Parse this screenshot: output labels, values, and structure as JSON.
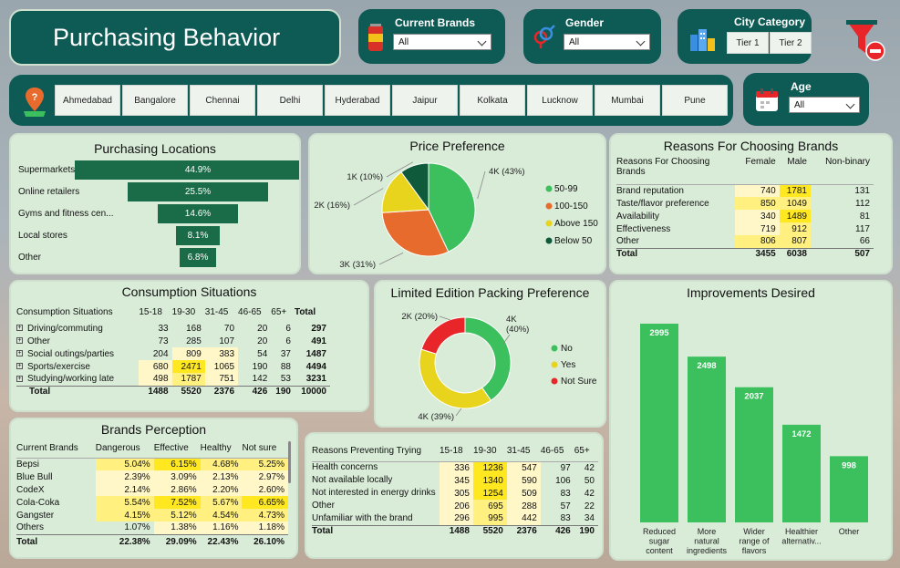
{
  "header": {
    "title": "Purchasing Behavior"
  },
  "filters": {
    "current_brands": {
      "label": "Current Brands",
      "value": "All",
      "icon": "energy-can-icon"
    },
    "gender": {
      "label": "Gender",
      "value": "All",
      "icon": "gender-icon"
    },
    "city_category": {
      "label": "City Category",
      "tiers": [
        "Tier 1",
        "Tier 2"
      ],
      "icon": "city-buildings-icon"
    },
    "clear_filters_icon": "filter-clear-icon",
    "cities": [
      "Ahmedabad",
      "Bangalore",
      "Chennai",
      "Delhi",
      "Hyderabad",
      "Jaipur",
      "Kolkata",
      "Lucknow",
      "Mumbai",
      "Pune"
    ],
    "city_icon": "map-pin-icon",
    "age": {
      "label": "Age",
      "value": "All",
      "icon": "calendar-icon"
    }
  },
  "purchasing_locations": {
    "title": "Purchasing Locations",
    "items": [
      {
        "label": "Supermarkets",
        "value": "44.9%",
        "pct": 44.9
      },
      {
        "label": "Online retailers",
        "value": "25.5%",
        "pct": 25.5
      },
      {
        "label": "Gyms and fitness cen...",
        "value": "14.6%",
        "pct": 14.6
      },
      {
        "label": "Local stores",
        "value": "8.1%",
        "pct": 8.1
      },
      {
        "label": "Other",
        "value": "6.8%",
        "pct": 6.8
      }
    ]
  },
  "price_preference": {
    "title": "Price Preference",
    "chart_data": {
      "type": "pie",
      "slices": [
        {
          "label": "50-99",
          "value": 43,
          "text": "4K (43%)",
          "color": "#3cbf5d"
        },
        {
          "label": "100-150",
          "value": 31,
          "text": "3K (31%)",
          "color": "#e86b2e"
        },
        {
          "label": "Above 150",
          "value": 16,
          "text": "2K (16%)",
          "color": "#e8d41c"
        },
        {
          "label": "Below 50",
          "value": 10,
          "text": "1K (10%)",
          "color": "#0e5a3a"
        }
      ]
    }
  },
  "reasons_choosing": {
    "title": "Reasons For Choosing Brands",
    "headers": [
      "Reasons For Choosing Brands",
      "Female",
      "Male",
      "Non-binary"
    ],
    "rows": [
      [
        "Brand reputation",
        "740",
        "1781",
        "131"
      ],
      [
        "Taste/flavor preference",
        "850",
        "1049",
        "112"
      ],
      [
        "Availability",
        "340",
        "1489",
        "81"
      ],
      [
        "Effectiveness",
        "719",
        "912",
        "117"
      ],
      [
        "Other",
        "806",
        "807",
        "66"
      ]
    ],
    "total": [
      "Total",
      "3455",
      "6038",
      "507"
    ]
  },
  "consumption": {
    "title": "Consumption Situations",
    "headers": [
      "Consumption Situations",
      "15-18",
      "19-30",
      "31-45",
      "46-65",
      "65+",
      "Total"
    ],
    "rows": [
      [
        "Driving/commuting",
        "33",
        "168",
        "70",
        "20",
        "6",
        "297"
      ],
      [
        "Other",
        "73",
        "285",
        "107",
        "20",
        "6",
        "491"
      ],
      [
        "Social outings/parties",
        "204",
        "809",
        "383",
        "54",
        "37",
        "1487"
      ],
      [
        "Sports/exercise",
        "680",
        "2471",
        "1065",
        "190",
        "88",
        "4494"
      ],
      [
        "Studying/working late",
        "498",
        "1787",
        "751",
        "142",
        "53",
        "3231"
      ]
    ],
    "total": [
      "Total",
      "1488",
      "5520",
      "2376",
      "426",
      "190",
      "10000"
    ]
  },
  "limited_edition": {
    "title": "Limited Edition Packing Preference",
    "chart_data": {
      "type": "pie",
      "slices": [
        {
          "label": "No",
          "value": 40,
          "text_a": "4K",
          "text_b": "(40%)",
          "color": "#3cbf5d"
        },
        {
          "label": "Yes",
          "value": 39,
          "text_a": "4K (39%)",
          "color": "#e8d41c"
        },
        {
          "label": "Not Sure",
          "value": 20,
          "text_a": "2K (20%)",
          "color": "#e8262a"
        }
      ]
    }
  },
  "improvements": {
    "title": "Improvements Desired",
    "chart_data": {
      "type": "bar",
      "categories": [
        "Reduced sugar content",
        "More natural ingredients",
        "Wider range of flavors",
        "Healthier alternativ...",
        "Other"
      ],
      "cat_lines": [
        [
          "Reduced",
          "sugar",
          "content"
        ],
        [
          "More",
          "natural",
          "ingredients"
        ],
        [
          "Wider",
          "range of",
          "flavors"
        ],
        [
          "Healthier",
          "alternativ..."
        ],
        [
          "Other"
        ]
      ],
      "values": [
        2995,
        2498,
        2037,
        1472,
        998
      ],
      "labels": [
        "2995",
        "2498",
        "2037",
        "1472",
        "998"
      ],
      "color": "#3cbf5d"
    }
  },
  "brands_perception": {
    "title": "Brands Perception",
    "headers": [
      "Current Brands",
      "Dangerous",
      "Effective",
      "Healthy",
      "Not sure"
    ],
    "rows": [
      [
        "Bepsi",
        "5.04%",
        "6.15%",
        "4.68%",
        "5.25%"
      ],
      [
        "Blue Bull",
        "2.39%",
        "3.09%",
        "2.13%",
        "2.97%"
      ],
      [
        "CodeX",
        "2.14%",
        "2.86%",
        "2.20%",
        "2.60%"
      ],
      [
        "Cola-Coka",
        "5.54%",
        "7.52%",
        "5.67%",
        "6.65%"
      ],
      [
        "Gangster",
        "4.15%",
        "5.12%",
        "4.54%",
        "4.73%"
      ],
      [
        "Others",
        "1.07%",
        "1.38%",
        "1.16%",
        "1.18%"
      ]
    ],
    "total": [
      "Total",
      "22.38%",
      "29.09%",
      "22.43%",
      "26.10%"
    ]
  },
  "reasons_preventing": {
    "headers": [
      "Reasons Preventing Trying",
      "15-18",
      "19-30",
      "31-45",
      "46-65",
      "65+"
    ],
    "rows": [
      [
        "Health concerns",
        "336",
        "1236",
        "547",
        "97",
        "42"
      ],
      [
        "Not available locally",
        "345",
        "1340",
        "590",
        "106",
        "50"
      ],
      [
        "Not interested in energy drinks",
        "305",
        "1254",
        "509",
        "83",
        "42"
      ],
      [
        "Other",
        "206",
        "695",
        "288",
        "57",
        "22"
      ],
      [
        "Unfamiliar with the brand",
        "296",
        "995",
        "442",
        "83",
        "34"
      ]
    ],
    "total": [
      "Total",
      "1488",
      "5520",
      "2376",
      "426",
      "190"
    ]
  }
}
